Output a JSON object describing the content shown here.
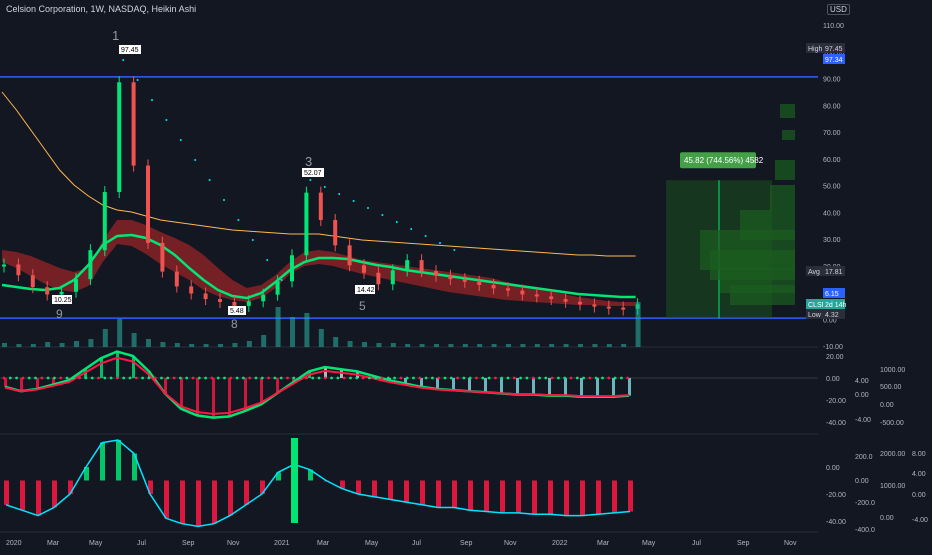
{
  "header": {
    "title": "Celsion Corporation, 1W, NASDAQ, Heikin Ashi",
    "currency": "USD"
  },
  "colors": {
    "background": "#131722",
    "up": "#26a69a",
    "down": "#ef5350",
    "bright_green": "#00e676",
    "red": "#ff1744",
    "blue_line": "#2962ff",
    "cyan": "#00e5ff",
    "yellow": "#ffb74d",
    "white": "#e0e0e0"
  },
  "price_labels": {
    "high_label": "High",
    "high_value": "97.45",
    "blue_line_value": "97.34",
    "avg_label": "Avg",
    "avg_value": "17.81",
    "green_value": "6.15",
    "ticker": "CLSN",
    "countdown": "2d 14h",
    "low_label": "Low",
    "low_value": "4.32"
  },
  "annotations": {
    "measure": "45.82 (744.56%) 4582",
    "peak1": "97.45",
    "peak2": "52.07",
    "low1": "10.25",
    "low2": "5.48",
    "low3": "14.42",
    "wave1": "1",
    "wave3": "3",
    "wave5": "5",
    "wave8": "8",
    "wave9": "9"
  },
  "chart_data": [
    {
      "type": "line",
      "panel": "price",
      "yscale": "log",
      "ylim": [
        -10,
        110
      ],
      "yticks": [
        "110.00",
        "100.00",
        "90.00",
        "80.00",
        "70.00",
        "60.00",
        "50.00",
        "40.00",
        "30.00",
        "20.00",
        "10.00",
        "0.00",
        "-10.00"
      ],
      "x": [
        "2020",
        "Mar",
        "May",
        "Jul",
        "Sep",
        "Nov",
        "2021",
        "Mar",
        "May",
        "Jul",
        "Sep",
        "Nov",
        "2022",
        "Mar",
        "May",
        "Jul",
        "Sep",
        "Nov"
      ],
      "series": [
        {
          "values": [
            22.5,
            18.1,
            13.2,
            10.2,
            11.3,
            16.5,
            28.4,
            52.3,
            97.45,
            63.2,
            31.4,
            19.6,
            13.5,
            10.6,
            8.3,
            7.1,
            5.5,
            7.4,
            10.1,
            15.6,
            26.3,
            52.07,
            40.8,
            30.4,
            22.2,
            19.1,
            14.4,
            20.1,
            24.3,
            19.8,
            17.9,
            16.5,
            15.4,
            14.1,
            12.7,
            11.8,
            10.2,
            9.4,
            8.3,
            7.2,
            6.1,
            5.2,
            4.8,
            4.32,
            6.15
          ]
        }
      ],
      "horizontal_lines": [
        97.34,
        6.15
      ],
      "measurement": {
        "from": 6.15,
        "to": 51.97,
        "change": "45.82 (744.56%) 4582"
      }
    },
    {
      "type": "area",
      "panel": "oscillator-1",
      "yticks_left": [
        "20.00",
        "0.00",
        "-20.00",
        "-40.00"
      ],
      "yticks_mid": [
        "4.00",
        "0.00",
        "-4.00"
      ],
      "yticks_right": [
        "1000.00",
        "500.00",
        "0.00",
        "-500.00"
      ],
      "series": [
        {
          "values": [
            -8,
            -12,
            -10,
            -6,
            -2,
            8,
            18,
            24,
            20,
            6,
            -14,
            -28,
            -34,
            -36,
            -35,
            -30,
            -24,
            -14,
            -4,
            6,
            10,
            8,
            6,
            2,
            -2,
            -5,
            -8,
            -10,
            -11,
            -12,
            -13,
            -14,
            -15,
            -15,
            -16,
            -16,
            -17,
            -17,
            -17,
            -16
          ]
        }
      ]
    },
    {
      "type": "area",
      "panel": "oscillator-2",
      "yticks_left": [
        "0.00",
        "-20.00",
        "-40.00"
      ],
      "yticks_mid": [
        "200.0",
        "0.00",
        "-200.0",
        "-400.0"
      ],
      "yticks_right": [
        "2000.00",
        "1000.00",
        "0.00"
      ],
      "yticks_far": [
        "8.00",
        "4.00",
        "0.00",
        "-4.00"
      ],
      "series": [
        {
          "values": [
            -28,
            -32,
            -36,
            -30,
            -20,
            0,
            18,
            20,
            10,
            -20,
            -38,
            -42,
            -44,
            -42,
            -36,
            -28,
            -20,
            -4,
            2,
            -2,
            -10,
            -16,
            -20,
            -22,
            -24,
            -26,
            -28,
            -30,
            -30,
            -32,
            -33,
            -34,
            -34,
            -35,
            -35,
            -36,
            -36,
            -35,
            -34,
            -33
          ]
        }
      ]
    }
  ]
}
